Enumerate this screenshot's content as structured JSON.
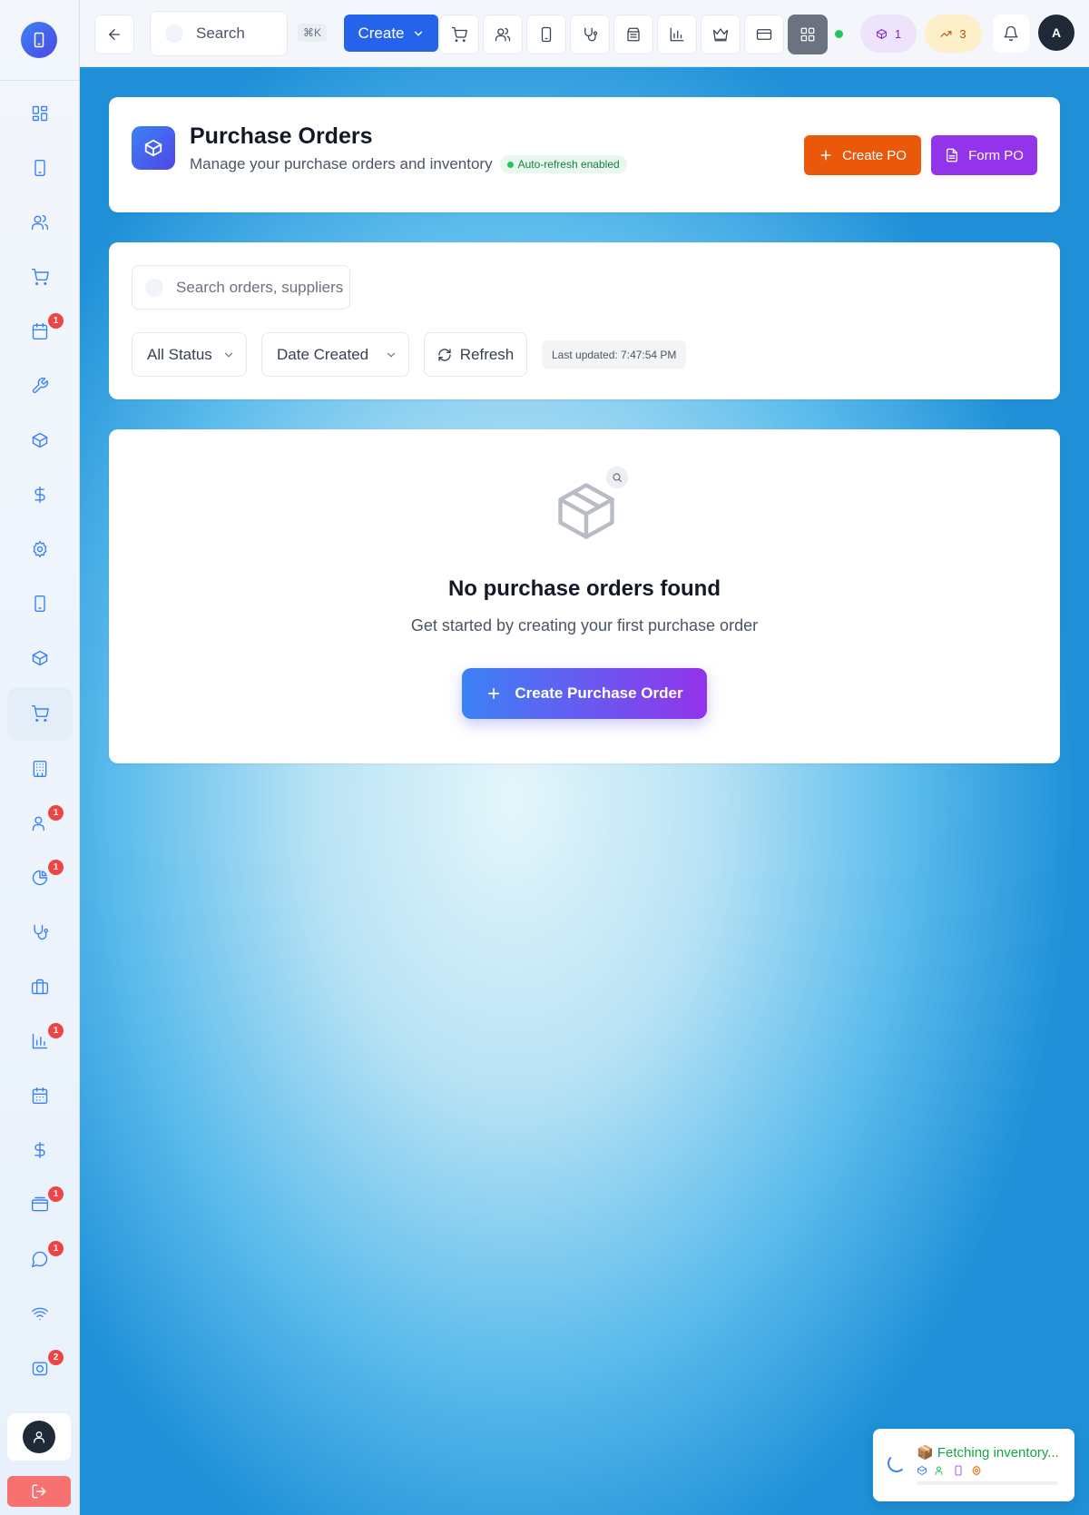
{
  "topbar": {
    "search_placeholder": "Search",
    "shortcut": "⌘K",
    "create_label": "Create",
    "notifications_pill": "1",
    "trends_pill": "3",
    "avatar_initial": "A"
  },
  "header": {
    "title": "Purchase Orders",
    "subtitle": "Manage your purchase orders and inventory",
    "auto_refresh": "Auto-refresh enabled",
    "create_po": "Create PO",
    "form_po": "Form PO"
  },
  "filters": {
    "search_placeholder": "Search orders, suppliers",
    "status_select": "All Status",
    "sort_select": "Date Created",
    "refresh": "Refresh",
    "last_updated": "Last updated: 7:47:54 PM"
  },
  "empty_state": {
    "title": "No purchase orders found",
    "subtitle": "Get started by creating your first purchase order",
    "button": "Create Purchase Order"
  },
  "toast": {
    "text": "📦 Fetching inventory...",
    "progress": 0
  },
  "sidebar": {
    "badges": {
      "calendar": "1",
      "customers": "1",
      "pie": "1",
      "reports": "1",
      "billing": "1",
      "chat": "1",
      "settings2": "2"
    }
  },
  "colors": {
    "primary": "#2563eb",
    "orange": "#ea580c",
    "purple": "#9333ea",
    "success": "#22c55e",
    "badge": "#ef4444"
  }
}
